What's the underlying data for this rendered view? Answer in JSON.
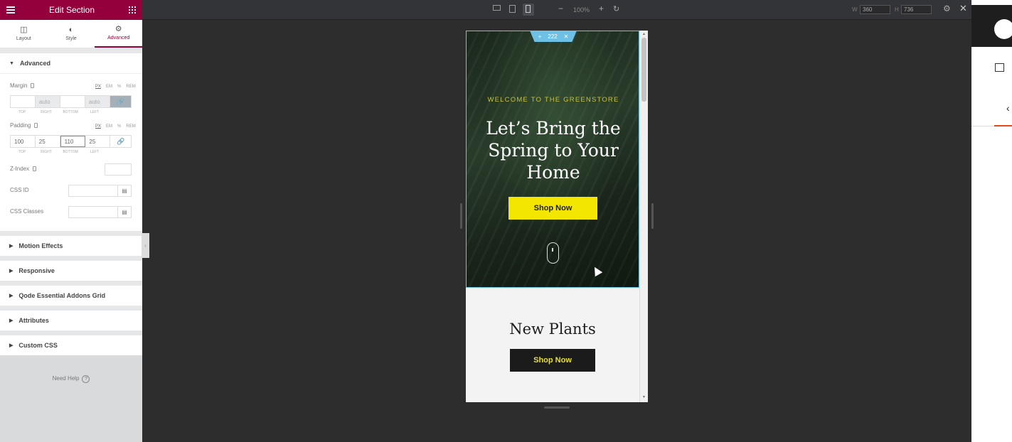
{
  "panel": {
    "title": "Edit Section",
    "tabs": [
      {
        "label": "Layout",
        "icon": "layout-icon"
      },
      {
        "label": "Style",
        "icon": "half-circle-icon"
      },
      {
        "label": "Advanced",
        "icon": "gear-icon",
        "active": true
      }
    ],
    "advanced": {
      "title": "Advanced",
      "margin": {
        "label": "Margin",
        "units": [
          "PX",
          "EM",
          "%",
          "REM"
        ],
        "values": [
          "",
          "auto",
          "",
          "auto"
        ],
        "sublabels": [
          "TOP",
          "RIGHT",
          "BOTTOM",
          "LEFT"
        ]
      },
      "padding": {
        "label": "Padding",
        "units": [
          "PX",
          "EM",
          "%",
          "REM"
        ],
        "values": [
          "100",
          "25",
          "110",
          "25"
        ],
        "sublabels": [
          "TOP",
          "RIGHT",
          "BOTTOM",
          "LEFT"
        ]
      },
      "zindex_label": "Z-Index",
      "cssid_label": "CSS ID",
      "cssclasses_label": "CSS Classes"
    },
    "sections": [
      "Motion Effects",
      "Responsive",
      "Qode Essential Addons Grid",
      "Attributes",
      "Custom CSS"
    ],
    "need_help": "Need Help",
    "colors": {
      "brand": "#93003c",
      "link_active": "#a4afb7"
    }
  },
  "topbar": {
    "zoom": "100%",
    "width_label": "W",
    "width_value": "360",
    "height_label": "H",
    "height_value": "736",
    "active_device": "mobile-icon"
  },
  "preview": {
    "section_handle": "222",
    "welcome": "WELCOME TO THE GREENSTORE",
    "headline": "Let’s Bring the Spring to Your Home",
    "hero_button": "Shop Now",
    "new_plants": "New Plants",
    "plants_button": "Shop Now",
    "colors": {
      "hero_button_bg": "#f3e600",
      "welcome_text": "#c6c13a",
      "handle": "#6ec1e4",
      "dark_button": "#1b1b1b"
    }
  }
}
